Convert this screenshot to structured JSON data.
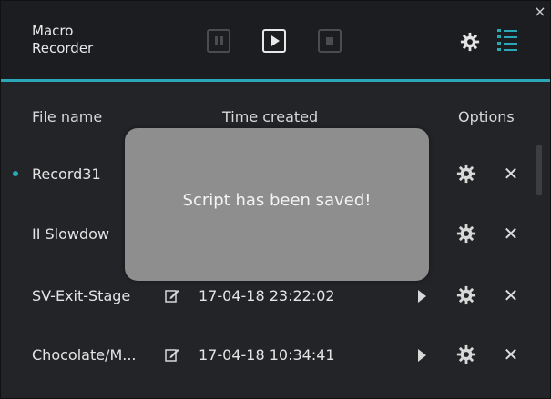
{
  "app": {
    "title": "Macro\nRecorder",
    "close_glyph": "×"
  },
  "toolbar": {
    "pause": "pause-icon",
    "play": "play-icon",
    "stop": "stop-icon",
    "settings": "gear-icon",
    "list": "list-icon"
  },
  "colors": {
    "accent": "#2aa8b8",
    "background": "#222427",
    "toast": "#8e8e8e"
  },
  "table": {
    "headers": {
      "file_name": "File name",
      "time_created": "Time created",
      "options": "Options"
    },
    "rows": [
      {
        "name": "Record31",
        "created": "",
        "active": true
      },
      {
        "name": "II Slowdow",
        "created": "",
        "active": false
      },
      {
        "name": "SV-Exit-Stage",
        "created": "17-04-18 23:22:02",
        "active": false
      },
      {
        "name": "Chocolate/M...",
        "created": "17-04-18 10:34:41",
        "active": false
      }
    ],
    "row_delete_glyph": "✕"
  },
  "toast": {
    "message": "Script has been saved!"
  }
}
